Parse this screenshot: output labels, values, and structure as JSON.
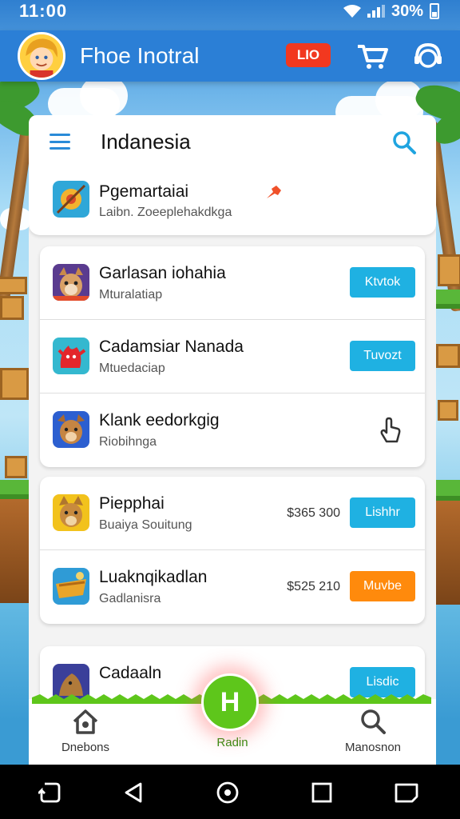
{
  "status_bar": {
    "time": "11:00",
    "battery": "30%"
  },
  "header": {
    "title": "Fhoe Inotral",
    "badge": "LIO"
  },
  "panel": {
    "title": "Indanesia",
    "pinned": {
      "name": "Pgemartaiai",
      "subtitle": "Laibn. Zoeeplehakdkga"
    }
  },
  "groups": [
    [
      {
        "name": "Garlasan iohahia",
        "subtitle": "Mturalatiap",
        "action": "Ktvtok",
        "action_color": "#1fb1e2"
      },
      {
        "name": "Cadamsiar Nanada",
        "subtitle": "Mtuedaciap",
        "action": "Tuvozt",
        "action_color": "#1fb1e2"
      },
      {
        "name": "Klank eedorkgig",
        "subtitle": "Riobihnga",
        "action": "",
        "action_icon": "hand-pointer-icon"
      }
    ],
    [
      {
        "name": "Piepphai",
        "subtitle": "Buaiya Souitung",
        "price": "$365 300",
        "action": "Lishhr",
        "action_color": "#1fb1e2"
      },
      {
        "name": "Luaknqikadlan",
        "subtitle": "Gadlanisra",
        "price": "$525 210",
        "action": "Muvbe",
        "action_color": "#ff8a0c"
      }
    ],
    [
      {
        "name": "Cadaaln",
        "subtitle": "",
        "action": "Lisdic",
        "action_color": "#1fb1e2"
      }
    ]
  ],
  "bottom_nav": {
    "items": [
      {
        "label": "Dnebons",
        "icon": "home-icon"
      },
      {
        "label": "Radin",
        "icon": "h-icon",
        "center_letter": "H"
      },
      {
        "label": "Manosnon",
        "icon": "search-icon"
      }
    ]
  },
  "colors": {
    "accent_blue": "#2b7fd6",
    "button_blue": "#1fb1e2",
    "button_orange": "#ff8a0c",
    "badge_red": "#f2381f",
    "fab_green": "#5ec61b"
  }
}
